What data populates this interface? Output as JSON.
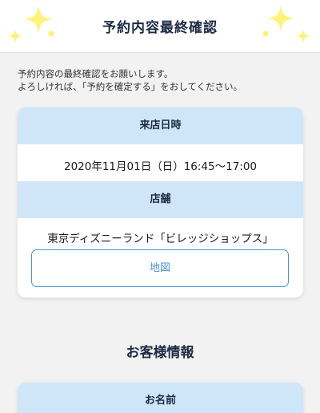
{
  "header": {
    "title": "予約内容最終確認"
  },
  "intro": {
    "line1": "予約内容の最終確認をお願いします。",
    "line2": "よろしければ、「予約を確定する」をおしてください。"
  },
  "visit": {
    "heading": "来店日時",
    "value": "2020年11月01日（日）16:45〜17:00"
  },
  "store": {
    "heading": "店舗",
    "value": "東京ディズニーランド「ビレッジショップス」",
    "map_label": "地図"
  },
  "customer": {
    "section_title": "お客様情報",
    "name_heading": "お名前"
  },
  "colors": {
    "accent": "#4a90d9",
    "header_band": "#cfe6f8",
    "sparkle": "#fff27a"
  }
}
